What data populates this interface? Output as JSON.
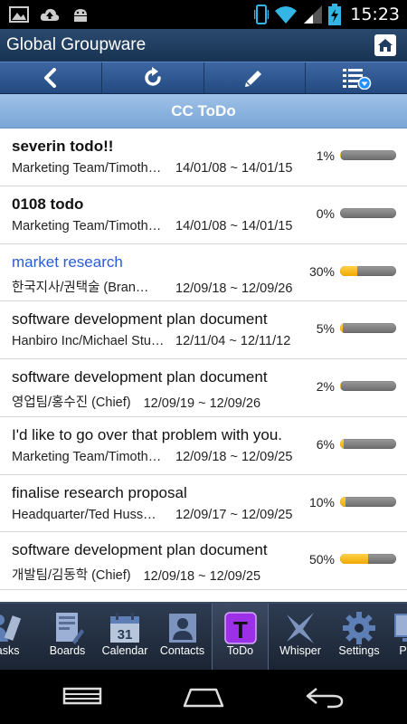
{
  "status_bar": {
    "time": "15:23",
    "left_icons": [
      "image-icon",
      "cloud-upload-icon",
      "android-icon"
    ],
    "right_icons": [
      "vibrate-icon",
      "wifi-icon",
      "signal-icon",
      "battery-charging-icon"
    ]
  },
  "app": {
    "title": "Global Groupware"
  },
  "toolbar": {
    "buttons": [
      "back-icon",
      "refresh-icon",
      "edit-icon",
      "list-filter-icon"
    ]
  },
  "section": {
    "title": "CC ToDo"
  },
  "todos": [
    {
      "title": "severin todo!!",
      "team": "Marketing Team/Timoth…",
      "dates": "14/01/08 ~ 14/01/15",
      "percent": "1%",
      "progress": 1,
      "style": "bold"
    },
    {
      "title": "0108 todo",
      "team": "Marketing Team/Timoth…",
      "dates": "14/01/08 ~ 14/01/15",
      "percent": "0%",
      "progress": 0,
      "style": "bold"
    },
    {
      "title": "market research",
      "team": "한국지사/권택술 (Bran…",
      "dates": "12/09/18 ~ 12/09/26",
      "percent": "30%",
      "progress": 30,
      "style": "link"
    },
    {
      "title": "software development plan document",
      "team": "Hanbiro Inc/Michael Stu…",
      "dates": "12/11/04 ~ 12/11/12",
      "percent": "5%",
      "progress": 5,
      "style": "normal"
    },
    {
      "title": " software development plan document",
      "team": "영업팀/홍수진 (Chief)",
      "dates": "12/09/19 ~ 12/09/26",
      "percent": "2%",
      "progress": 2,
      "style": "normal"
    },
    {
      "title": "I'd like to go over that problem with you.",
      "team": "Marketing Team/Timoth…",
      "dates": "12/09/18 ~ 12/09/25",
      "percent": "6%",
      "progress": 6,
      "style": "normal"
    },
    {
      "title": "finalise research proposal",
      "team": "Headquarter/Ted Huss…",
      "dates": "12/09/17 ~ 12/09/25",
      "percent": "10%",
      "progress": 10,
      "style": "normal"
    },
    {
      "title": "software development plan document",
      "team": "개발팀/김동학 (Chief)",
      "dates": "12/09/18 ~ 12/09/25",
      "percent": "50%",
      "progress": 50,
      "style": "normal"
    }
  ],
  "tabs": [
    {
      "label": "Tasks",
      "icon": "tasks-icon",
      "active": false
    },
    {
      "label": "Boards",
      "icon": "boards-icon",
      "active": false
    },
    {
      "label": "Calendar",
      "icon": "calendar-icon",
      "active": false,
      "icon_text": "31"
    },
    {
      "label": "Contacts",
      "icon": "contacts-icon",
      "active": false
    },
    {
      "label": "ToDo",
      "icon": "todo-icon",
      "active": true,
      "icon_text": "T"
    },
    {
      "label": "Whisper",
      "icon": "whisper-icon",
      "active": false
    },
    {
      "label": "Settings",
      "icon": "settings-icon",
      "active": false
    },
    {
      "label": "PC",
      "icon": "pc-icon",
      "active": false
    }
  ],
  "nav": {
    "buttons": [
      "recent-apps-icon",
      "home-icon",
      "back-icon"
    ]
  },
  "colors": {
    "title_bar": "#1f3d60",
    "toolbar": "#2f5790",
    "section_header": "#8cb4df",
    "link": "#2a5bd7",
    "progress_fill": "#f5b800",
    "progress_track": "#7d7d7d",
    "todo_active": "#8a2be2"
  }
}
